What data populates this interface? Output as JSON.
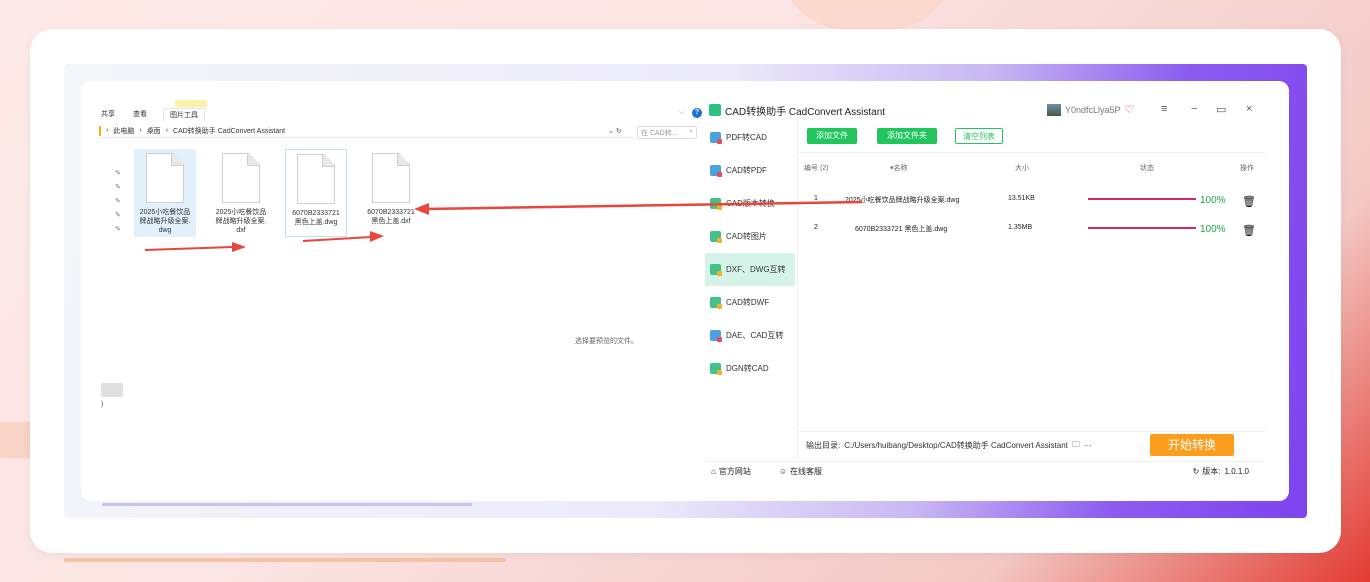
{
  "explorer": {
    "ribbon": {
      "tabs": [
        "共享",
        "查看",
        "图片工具"
      ]
    },
    "breadcrumb": {
      "sep": "›",
      "items": [
        "此电脑",
        "桌面",
        "CAD转换助手 CadConvert Assistant"
      ]
    },
    "search_placeholder": "在 CAD转...",
    "files": [
      {
        "name": "2025小吃餐饮品\n牌战略升级全案.\ndwg"
      },
      {
        "name": "2025小吃餐饮品\n牌战略升级全案.\ndxf"
      },
      {
        "name": "6070B2333721\n黑色上盖.dwg"
      },
      {
        "name": "6070B2333721\n黑色上盖.dxf"
      }
    ],
    "preview_message": "选择要预览的文件。",
    "paren_text": ")"
  },
  "app": {
    "title": "CAD转换助手 CadConvert Assistant",
    "username": "Y0ndfcLlya5P",
    "sidebar": [
      {
        "label": "PDF转CAD",
        "icon": "pdf-to-cad-icon"
      },
      {
        "label": "CAD转PDF",
        "icon": "cad-to-pdf-icon"
      },
      {
        "label": "CAD版本转换",
        "icon": "cad-version-icon"
      },
      {
        "label": "CAD转图片",
        "icon": "cad-to-image-icon"
      },
      {
        "label": "DXF、DWG互转",
        "icon": "dxf-dwg-icon",
        "active": true
      },
      {
        "label": "CAD转DWF",
        "icon": "cad-to-dwf-icon"
      },
      {
        "label": "DAE、CAD互转",
        "icon": "dae-cad-icon"
      },
      {
        "label": "DGN转CAD",
        "icon": "dgn-to-cad-icon"
      }
    ],
    "buttons": {
      "add_file": "添加文件",
      "add_folder": "添加文件夹",
      "clear_list": "清空列表"
    },
    "table": {
      "headers": {
        "num": "编号 (2)",
        "name": "▾名称",
        "size": "大小",
        "status": "状态",
        "action": "操作"
      },
      "rows": [
        {
          "num": "1",
          "name": "2025小吃餐饮品牌战略升级全案.dwg",
          "size": "13.51KB",
          "progress": 1.0,
          "pct": "100%"
        },
        {
          "num": "2",
          "name": "6070B2333721 黑色上盖.dwg",
          "size": "1.35MB",
          "progress": 1.0,
          "pct": "100%"
        }
      ]
    },
    "output": {
      "label": "输出目录:",
      "path": "C:/Users/huibang/Desktop/CAD转换助手 CadConvert Assistant",
      "more": "···"
    },
    "start_button": "开始转换",
    "footer": {
      "website": "官方网站",
      "support": "在线客服",
      "version_label": "版本:",
      "version": "1.0.1.0"
    },
    "colors": {
      "accent": "#21c55d",
      "progress": "#d6265c",
      "start": "#fb9d1d",
      "annotation_arrow": "#e8453c"
    }
  }
}
